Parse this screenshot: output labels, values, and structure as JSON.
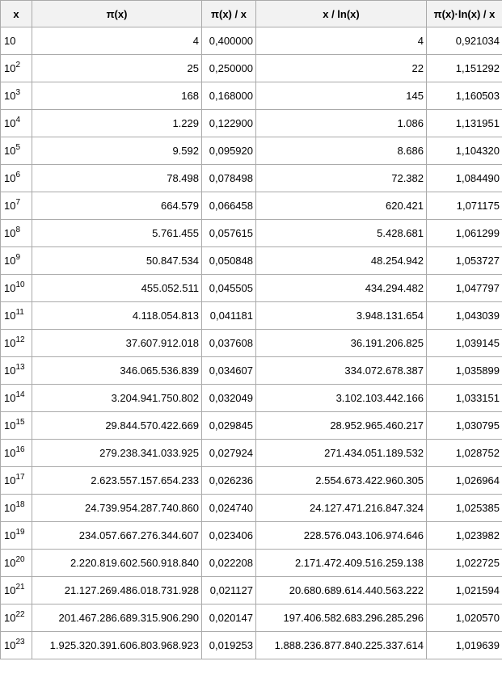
{
  "table": {
    "headers": [
      "x",
      "π(x)",
      "π(x) / x",
      "x / ln(x)",
      "π(x)·ln(x) / x"
    ],
    "rows": [
      {
        "base": "10",
        "exp": "",
        "pi": "4",
        "ratio": "0,400000",
        "xln": "4",
        "norm": "0,921034"
      },
      {
        "base": "10",
        "exp": "2",
        "pi": "25",
        "ratio": "0,250000",
        "xln": "22",
        "norm": "1,151292"
      },
      {
        "base": "10",
        "exp": "3",
        "pi": "168",
        "ratio": "0,168000",
        "xln": "145",
        "norm": "1,160503"
      },
      {
        "base": "10",
        "exp": "4",
        "pi": "1.229",
        "ratio": "0,122900",
        "xln": "1.086",
        "norm": "1,131951"
      },
      {
        "base": "10",
        "exp": "5",
        "pi": "9.592",
        "ratio": "0,095920",
        "xln": "8.686",
        "norm": "1,104320"
      },
      {
        "base": "10",
        "exp": "6",
        "pi": "78.498",
        "ratio": "0,078498",
        "xln": "72.382",
        "norm": "1,084490"
      },
      {
        "base": "10",
        "exp": "7",
        "pi": "664.579",
        "ratio": "0,066458",
        "xln": "620.421",
        "norm": "1,071175"
      },
      {
        "base": "10",
        "exp": "8",
        "pi": "5.761.455",
        "ratio": "0,057615",
        "xln": "5.428.681",
        "norm": "1,061299"
      },
      {
        "base": "10",
        "exp": "9",
        "pi": "50.847.534",
        "ratio": "0,050848",
        "xln": "48.254.942",
        "norm": "1,053727"
      },
      {
        "base": "10",
        "exp": "10",
        "pi": "455.052.511",
        "ratio": "0,045505",
        "xln": "434.294.482",
        "norm": "1,047797"
      },
      {
        "base": "10",
        "exp": "11",
        "pi": "4.118.054.813",
        "ratio": "0,041181",
        "xln": "3.948.131.654",
        "norm": "1,043039"
      },
      {
        "base": "10",
        "exp": "12",
        "pi": "37.607.912.018",
        "ratio": "0,037608",
        "xln": "36.191.206.825",
        "norm": "1,039145"
      },
      {
        "base": "10",
        "exp": "13",
        "pi": "346.065.536.839",
        "ratio": "0,034607",
        "xln": "334.072.678.387",
        "norm": "1,035899"
      },
      {
        "base": "10",
        "exp": "14",
        "pi": "3.204.941.750.802",
        "ratio": "0,032049",
        "xln": "3.102.103.442.166",
        "norm": "1,033151"
      },
      {
        "base": "10",
        "exp": "15",
        "pi": "29.844.570.422.669",
        "ratio": "0,029845",
        "xln": "28.952.965.460.217",
        "norm": "1,030795"
      },
      {
        "base": "10",
        "exp": "16",
        "pi": "279.238.341.033.925",
        "ratio": "0,027924",
        "xln": "271.434.051.189.532",
        "norm": "1,028752"
      },
      {
        "base": "10",
        "exp": "17",
        "pi": "2.623.557.157.654.233",
        "ratio": "0,026236",
        "xln": "2.554.673.422.960.305",
        "norm": "1,026964"
      },
      {
        "base": "10",
        "exp": "18",
        "pi": "24.739.954.287.740.860",
        "ratio": "0,024740",
        "xln": "24.127.471.216.847.324",
        "norm": "1,025385"
      },
      {
        "base": "10",
        "exp": "19",
        "pi": "234.057.667.276.344.607",
        "ratio": "0,023406",
        "xln": "228.576.043.106.974.646",
        "norm": "1,023982"
      },
      {
        "base": "10",
        "exp": "20",
        "pi": "2.220.819.602.560.918.840",
        "ratio": "0,022208",
        "xln": "2.171.472.409.516.259.138",
        "norm": "1,022725"
      },
      {
        "base": "10",
        "exp": "21",
        "pi": "21.127.269.486.018.731.928",
        "ratio": "0,021127",
        "xln": "20.680.689.614.440.563.222",
        "norm": "1,021594"
      },
      {
        "base": "10",
        "exp": "22",
        "pi": "201.467.286.689.315.906.290",
        "ratio": "0,020147",
        "xln": "197.406.582.683.296.285.296",
        "norm": "1,020570"
      },
      {
        "base": "10",
        "exp": "23",
        "pi": "1.925.320.391.606.803.968.923",
        "ratio": "0,019253",
        "xln": "1.888.236.877.840.225.337.614",
        "norm": "1,019639"
      }
    ]
  }
}
